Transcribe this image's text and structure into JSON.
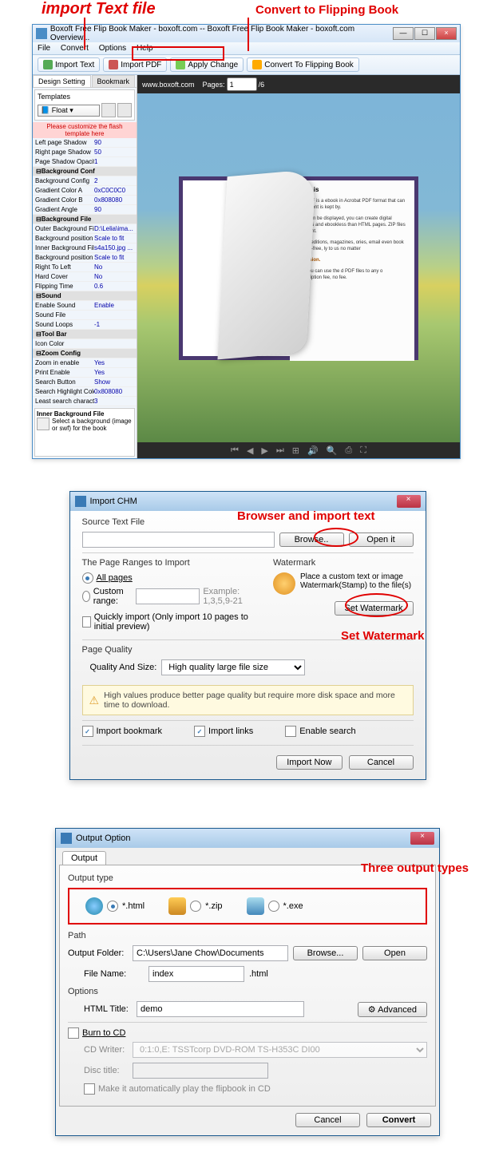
{
  "annotations": {
    "import_text": "import Text file",
    "convert": "Convert to Flipping Book",
    "browser_import": "Browser and import text",
    "set_watermark": "Set Watermark",
    "three_output": "Three output types"
  },
  "main": {
    "title": "Boxoft Free Flip Book Maker - boxoft.com -- Boxoft Free Flip Book Maker - boxoft.com Overview...",
    "menu": [
      "File",
      "Convert",
      "Options",
      "Help"
    ],
    "toolbar": {
      "import_text": "Import Text",
      "import_pdf": "Import PDF",
      "apply_change": "Apply Change",
      "convert": "Convert To Flipping Book"
    },
    "side": {
      "tab1": "Design Setting",
      "tab2": "Bookmark",
      "templates_label": "Templates",
      "float": "Float",
      "customize": "Please customize the flash template here"
    },
    "props": [
      {
        "cat": false,
        "name": "Left page Shadow",
        "val": "90"
      },
      {
        "cat": false,
        "name": "Right page Shadow",
        "val": "50"
      },
      {
        "cat": false,
        "name": "Page Shadow Opacity",
        "val": "1"
      },
      {
        "cat": true,
        "name": "Background Config",
        "val": ""
      },
      {
        "cat": false,
        "name": "Background Config",
        "val": "2"
      },
      {
        "cat": false,
        "name": "Gradient Color A",
        "val": "0xC0C0C0"
      },
      {
        "cat": false,
        "name": "Gradient Color B",
        "val": "0x808080"
      },
      {
        "cat": false,
        "name": "Gradient Angle",
        "val": "90"
      },
      {
        "cat": true,
        "name": "Background File",
        "val": ""
      },
      {
        "cat": false,
        "name": "Outer Background File",
        "val": "D:\\Lelia\\ima..."
      },
      {
        "cat": false,
        "name": "Background position",
        "val": "Scale to fit"
      },
      {
        "cat": false,
        "name": "Inner Background File",
        "val": "s4a150.jpg ..."
      },
      {
        "cat": false,
        "name": "Background position",
        "val": "Scale to fit"
      },
      {
        "cat": false,
        "name": "Right To Left",
        "val": "No"
      },
      {
        "cat": false,
        "name": "Hard Cover",
        "val": "No"
      },
      {
        "cat": false,
        "name": "Flipping Time",
        "val": "0.6"
      },
      {
        "cat": true,
        "name": "Sound",
        "val": ""
      },
      {
        "cat": false,
        "name": "Enable Sound",
        "val": "Enable"
      },
      {
        "cat": false,
        "name": "Sound File",
        "val": ""
      },
      {
        "cat": false,
        "name": "Sound Loops",
        "val": "-1"
      },
      {
        "cat": true,
        "name": "Tool Bar",
        "val": ""
      },
      {
        "cat": false,
        "name": "Icon Color",
        "val": ""
      },
      {
        "cat": true,
        "name": "Zoom Config",
        "val": ""
      },
      {
        "cat": false,
        "name": "Zoom in enable",
        "val": "Yes"
      },
      {
        "cat": false,
        "name": "Print Enable",
        "val": "Yes"
      },
      {
        "cat": false,
        "name": "Search Button",
        "val": "Show"
      },
      {
        "cat": false,
        "name": "Search Highlight Color",
        "val": "0x808080"
      },
      {
        "cat": false,
        "name": "Least search characters",
        "val": "3"
      }
    ],
    "inner_bg_label": "Inner Background File",
    "inner_bg_hint": "Select a background (image or swf) for the book",
    "preview": {
      "url": "www.boxoft.com",
      "pages_label": "Pages:",
      "page_current": "1",
      "page_total": "/6"
    },
    "book": {
      "heading": "What is",
      "p1": "Flip PDF is a ebook in Acrobat PDF format that can be content is kept by.",
      "p2": "book can be displayed, you can create digital catalogs and ebookless than HTML pages. ZIP files you want.",
      "p3": "tronic) editions, magazines, ories, email even book is royal-free, ly to us no matter",
      "conv": "onversion.",
      "p4": "ore, you can use the d PDF files to any o subscription fee, no fee."
    }
  },
  "import_dialog": {
    "title": "Import CHM",
    "source_label": "Source Text File",
    "browse": "Browse..",
    "open_it": "Open it",
    "ranges_label": "The Page Ranges to Import",
    "all_pages": "All pages",
    "custom_range": "Custom range:",
    "example": "Example: 1,3,5,9-21",
    "quickly": "Quickly import (Only import 10 pages to  initial  preview)",
    "watermark_label": "Watermark",
    "watermark_text": "Place a custom text or image Watermark(Stamp) to the file(s)",
    "set_watermark": "Set Watermark",
    "quality_label": "Page Quality",
    "quality_size": "Quality And Size:",
    "quality_value": "High quality large file size",
    "info": "High values produce better page quality but require more disk space and more time to download.",
    "import_bookmark": "Import bookmark",
    "import_links": "Import links",
    "enable_search": "Enable search",
    "import_now": "Import Now",
    "cancel": "Cancel"
  },
  "output_dialog": {
    "title": "Output Option",
    "tab": "Output",
    "output_type": "Output type",
    "html": "*.html",
    "zip": "*.zip",
    "exe": "*.exe",
    "path": "Path",
    "output_folder": "Output Folder:",
    "folder_val": "C:\\Users\\Jane Chow\\Documents",
    "browse": "Browse...",
    "open": "Open",
    "file_name": "File Name:",
    "file_val": "index",
    "file_ext": ".html",
    "options": "Options",
    "html_title": "HTML Title:",
    "html_title_val": "demo",
    "advanced": "Advanced",
    "burn_cd": "Burn to CD",
    "cd_writer": "CD Writer:",
    "cd_writer_val": "0:1:0,E: TSSTcorp DVD-ROM TS-H353C DI00",
    "disc_title": "Disc title:",
    "auto_play": "Make it automatically play the flipbook in CD",
    "cancel": "Cancel",
    "convert": "Convert"
  }
}
